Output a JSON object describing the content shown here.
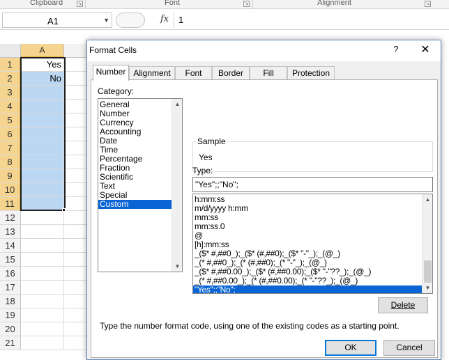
{
  "ribbon": {
    "groups": [
      "Clipboard",
      "Font",
      "Alignment"
    ]
  },
  "formula_bar": {
    "name_box": "A1",
    "fx_symbol": "fx",
    "value": "1"
  },
  "sheet": {
    "column": "A",
    "rows": [
      "1",
      "2",
      "3",
      "4",
      "5",
      "6",
      "7",
      "8",
      "9",
      "10",
      "11",
      "12",
      "13",
      "14",
      "15",
      "16",
      "17",
      "18",
      "19",
      "20",
      "21"
    ],
    "cells": [
      "Yes",
      "No",
      "",
      "",
      "",
      "",
      "",
      "",
      "",
      "",
      "",
      "",
      "",
      "",
      "",
      "",
      "",
      "",
      "",
      "",
      ""
    ]
  },
  "dialog": {
    "title": "Format Cells",
    "help": "?",
    "close": "✕",
    "tabs": [
      "Number",
      "Alignment",
      "Font",
      "Border",
      "Fill",
      "Protection"
    ],
    "category_label": "Category:",
    "categories": [
      "General",
      "Number",
      "Currency",
      "Accounting",
      "Date",
      "Time",
      "Percentage",
      "Fraction",
      "Scientific",
      "Text",
      "Special",
      "Custom"
    ],
    "selected_category": "Custom",
    "sample_label": "Sample",
    "sample_value": "Yes",
    "type_label": "Type:",
    "type_value": "\"Yes\";;\"No\";",
    "type_list": [
      "h:mm:ss",
      "m/d/yyyy h:mm",
      "mm:ss",
      "mm:ss.0",
      "@",
      "[h]:mm:ss",
      "_($* #,##0_);_($* (#,##0);_($* \"-\"_);_(@_)",
      "_(* #,##0_);_(* (#,##0);_(* \"-\"_);_(@_)",
      "_($* #,##0.00_);_($* (#,##0.00);_($* \"-\"??_);_(@_)",
      "_(* #,##0.00_);_(* (#,##0.00);_(* \"-\"??_);_(@_)",
      "\"Yes\";;\"No\";"
    ],
    "delete_label": "Delete",
    "hint": "Type the number format code, using one of the existing codes as a starting point.",
    "ok_label": "OK",
    "cancel_label": "Cancel"
  }
}
